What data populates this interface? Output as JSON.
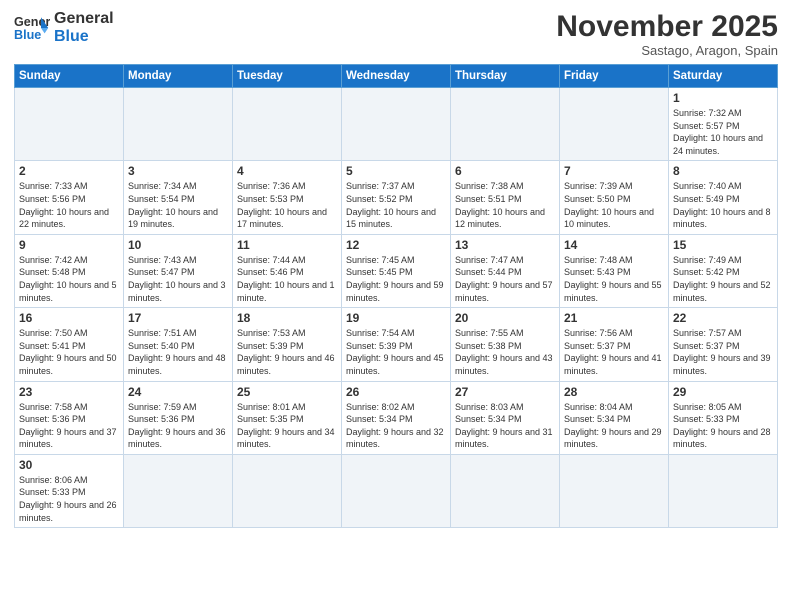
{
  "header": {
    "logo_general": "General",
    "logo_blue": "Blue",
    "month_title": "November 2025",
    "subtitle": "Sastago, Aragon, Spain"
  },
  "weekdays": [
    "Sunday",
    "Monday",
    "Tuesday",
    "Wednesday",
    "Thursday",
    "Friday",
    "Saturday"
  ],
  "weeks": [
    [
      {
        "day": "",
        "info": ""
      },
      {
        "day": "",
        "info": ""
      },
      {
        "day": "",
        "info": ""
      },
      {
        "day": "",
        "info": ""
      },
      {
        "day": "",
        "info": ""
      },
      {
        "day": "",
        "info": ""
      },
      {
        "day": "1",
        "info": "Sunrise: 7:32 AM\nSunset: 5:57 PM\nDaylight: 10 hours and 24 minutes."
      }
    ],
    [
      {
        "day": "2",
        "info": "Sunrise: 7:33 AM\nSunset: 5:56 PM\nDaylight: 10 hours and 22 minutes."
      },
      {
        "day": "3",
        "info": "Sunrise: 7:34 AM\nSunset: 5:54 PM\nDaylight: 10 hours and 19 minutes."
      },
      {
        "day": "4",
        "info": "Sunrise: 7:36 AM\nSunset: 5:53 PM\nDaylight: 10 hours and 17 minutes."
      },
      {
        "day": "5",
        "info": "Sunrise: 7:37 AM\nSunset: 5:52 PM\nDaylight: 10 hours and 15 minutes."
      },
      {
        "day": "6",
        "info": "Sunrise: 7:38 AM\nSunset: 5:51 PM\nDaylight: 10 hours and 12 minutes."
      },
      {
        "day": "7",
        "info": "Sunrise: 7:39 AM\nSunset: 5:50 PM\nDaylight: 10 hours and 10 minutes."
      },
      {
        "day": "8",
        "info": "Sunrise: 7:40 AM\nSunset: 5:49 PM\nDaylight: 10 hours and 8 minutes."
      }
    ],
    [
      {
        "day": "9",
        "info": "Sunrise: 7:42 AM\nSunset: 5:48 PM\nDaylight: 10 hours and 5 minutes."
      },
      {
        "day": "10",
        "info": "Sunrise: 7:43 AM\nSunset: 5:47 PM\nDaylight: 10 hours and 3 minutes."
      },
      {
        "day": "11",
        "info": "Sunrise: 7:44 AM\nSunset: 5:46 PM\nDaylight: 10 hours and 1 minute."
      },
      {
        "day": "12",
        "info": "Sunrise: 7:45 AM\nSunset: 5:45 PM\nDaylight: 9 hours and 59 minutes."
      },
      {
        "day": "13",
        "info": "Sunrise: 7:47 AM\nSunset: 5:44 PM\nDaylight: 9 hours and 57 minutes."
      },
      {
        "day": "14",
        "info": "Sunrise: 7:48 AM\nSunset: 5:43 PM\nDaylight: 9 hours and 55 minutes."
      },
      {
        "day": "15",
        "info": "Sunrise: 7:49 AM\nSunset: 5:42 PM\nDaylight: 9 hours and 52 minutes."
      }
    ],
    [
      {
        "day": "16",
        "info": "Sunrise: 7:50 AM\nSunset: 5:41 PM\nDaylight: 9 hours and 50 minutes."
      },
      {
        "day": "17",
        "info": "Sunrise: 7:51 AM\nSunset: 5:40 PM\nDaylight: 9 hours and 48 minutes."
      },
      {
        "day": "18",
        "info": "Sunrise: 7:53 AM\nSunset: 5:39 PM\nDaylight: 9 hours and 46 minutes."
      },
      {
        "day": "19",
        "info": "Sunrise: 7:54 AM\nSunset: 5:39 PM\nDaylight: 9 hours and 45 minutes."
      },
      {
        "day": "20",
        "info": "Sunrise: 7:55 AM\nSunset: 5:38 PM\nDaylight: 9 hours and 43 minutes."
      },
      {
        "day": "21",
        "info": "Sunrise: 7:56 AM\nSunset: 5:37 PM\nDaylight: 9 hours and 41 minutes."
      },
      {
        "day": "22",
        "info": "Sunrise: 7:57 AM\nSunset: 5:37 PM\nDaylight: 9 hours and 39 minutes."
      }
    ],
    [
      {
        "day": "23",
        "info": "Sunrise: 7:58 AM\nSunset: 5:36 PM\nDaylight: 9 hours and 37 minutes."
      },
      {
        "day": "24",
        "info": "Sunrise: 7:59 AM\nSunset: 5:36 PM\nDaylight: 9 hours and 36 minutes."
      },
      {
        "day": "25",
        "info": "Sunrise: 8:01 AM\nSunset: 5:35 PM\nDaylight: 9 hours and 34 minutes."
      },
      {
        "day": "26",
        "info": "Sunrise: 8:02 AM\nSunset: 5:34 PM\nDaylight: 9 hours and 32 minutes."
      },
      {
        "day": "27",
        "info": "Sunrise: 8:03 AM\nSunset: 5:34 PM\nDaylight: 9 hours and 31 minutes."
      },
      {
        "day": "28",
        "info": "Sunrise: 8:04 AM\nSunset: 5:34 PM\nDaylight: 9 hours and 29 minutes."
      },
      {
        "day": "29",
        "info": "Sunrise: 8:05 AM\nSunset: 5:33 PM\nDaylight: 9 hours and 28 minutes."
      }
    ],
    [
      {
        "day": "30",
        "info": "Sunrise: 8:06 AM\nSunset: 5:33 PM\nDaylight: 9 hours and 26 minutes."
      },
      {
        "day": "",
        "info": ""
      },
      {
        "day": "",
        "info": ""
      },
      {
        "day": "",
        "info": ""
      },
      {
        "day": "",
        "info": ""
      },
      {
        "day": "",
        "info": ""
      },
      {
        "day": "",
        "info": ""
      }
    ]
  ]
}
